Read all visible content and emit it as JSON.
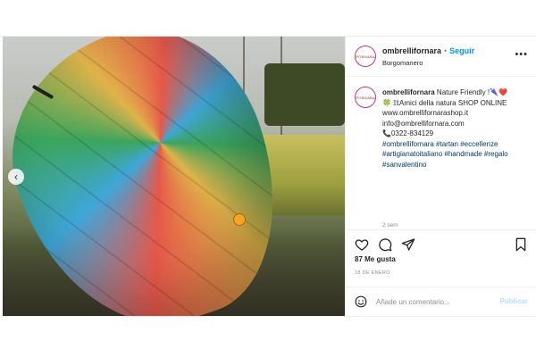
{
  "post": {
    "username": "ombrellifornara",
    "follow_label": "Seguir",
    "location": "Borgomanero",
    "avatar_logo_text": "FORNARA",
    "caption": {
      "text_intro": "Nature Friendly !🌂❤️",
      "line2": "🍀 𝕀𝕥Amici della natura SHOP ONLINE",
      "line3": "www.ombrellifornarashop.it",
      "line4": "info@ombrellifornara.com",
      "line5": "📞0322-834129",
      "hashtags": [
        "#ombrellifornara",
        "#tartan",
        "#eccellenze",
        "#artigianatoitaliano",
        "#handmade",
        "#regalo",
        "#sanvalentino"
      ]
    },
    "time_ago": "2 sem",
    "likes": "87 Me gusta",
    "date": "18 DE ENERO",
    "comment_placeholder": "Añade un comentario...",
    "publish_label": "Publicar"
  },
  "icons": {
    "heart": "heart-icon",
    "comment": "comment-icon",
    "share": "share-icon",
    "save": "bookmark-icon",
    "emoji": "emoji-icon",
    "more": "more-options-icon",
    "prev": "chevron-left-icon"
  },
  "colors": {
    "link": "#0095f6",
    "hashtag": "#00376b",
    "muted": "#8e8e8e",
    "publish_disabled": "#b2dffc"
  }
}
